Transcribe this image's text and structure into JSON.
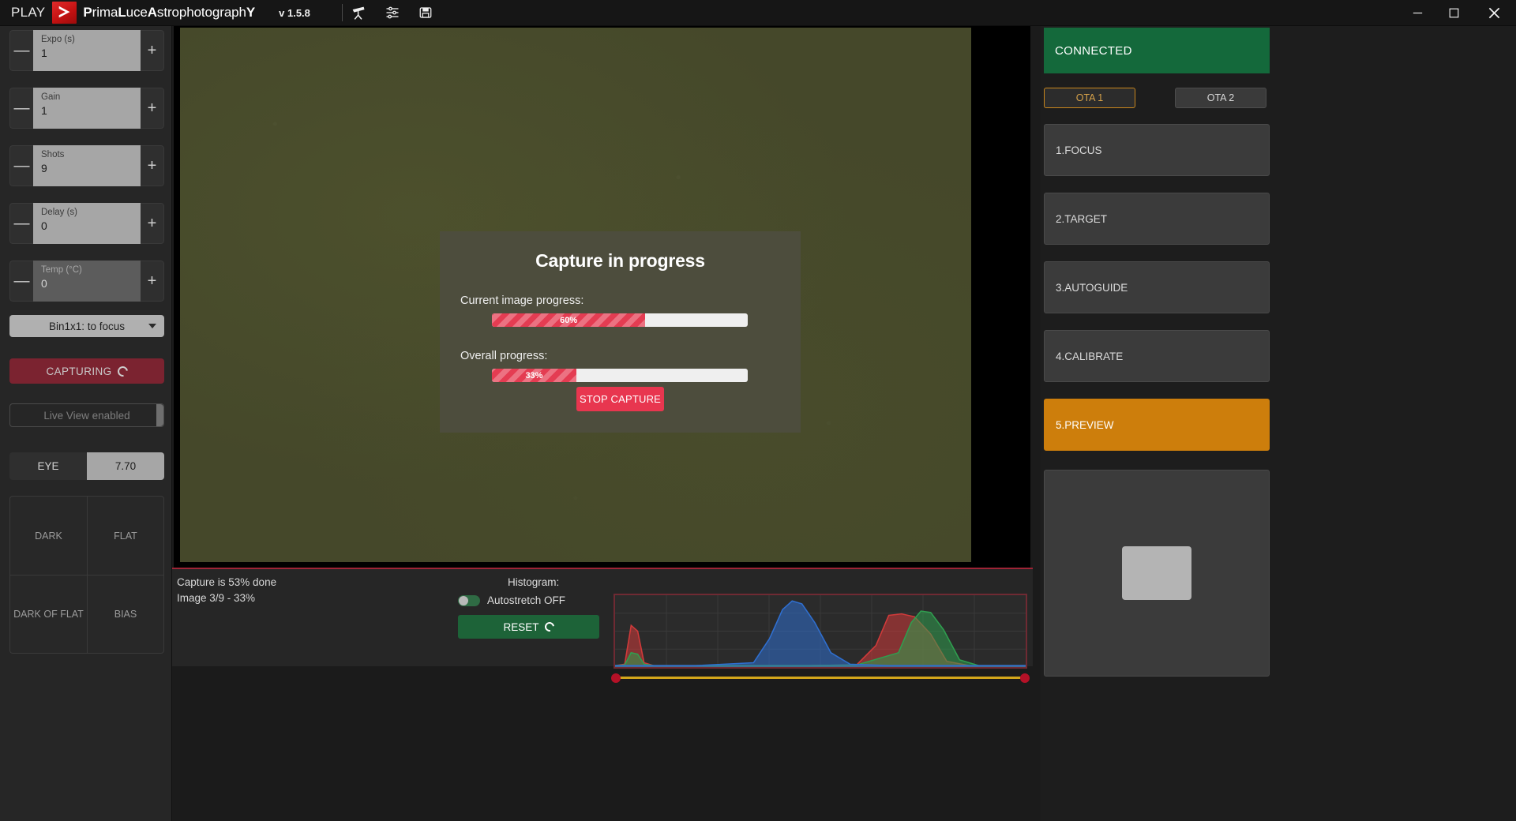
{
  "titlebar": {
    "play_label": "PLAY",
    "app_name_parts": [
      "P",
      "rima",
      "L",
      "uce",
      "A",
      "strophotograph",
      "Y"
    ],
    "app_name": "PrimaLuceAstrophotographY",
    "version": "v 1.5.8",
    "icons": [
      "telescope-icon",
      "sliders-icon",
      "save-icon"
    ],
    "window_controls": [
      "minimize",
      "maximize",
      "close"
    ]
  },
  "left_panel": {
    "steppers": [
      {
        "label": "Expo (s)",
        "value": "1",
        "minus": "—",
        "plus": "+",
        "disabled": false
      },
      {
        "label": "Gain",
        "value": "1",
        "minus": "—",
        "plus": "+",
        "disabled": false
      },
      {
        "label": "Shots",
        "value": "9",
        "minus": "—",
        "plus": "+",
        "disabled": false
      },
      {
        "label": "Delay (s)",
        "value": "0",
        "minus": "—",
        "plus": "+",
        "disabled": false
      },
      {
        "label": "Temp (°C)",
        "value": "0",
        "minus": "—",
        "plus": "+",
        "disabled": true
      }
    ],
    "bin_select": "Bin1x1: to focus",
    "capture_button": "CAPTURING",
    "liveview_button": "Live View enabled",
    "eye_label": "EYE",
    "eye_value": "7.70",
    "calibration": [
      "DARK",
      "FLAT",
      "DARK OF FLAT",
      "BIAS"
    ]
  },
  "modal": {
    "title": "Capture in progress",
    "current_label": "Current image progress:",
    "current_percent": 60,
    "current_percent_text": "60%",
    "overall_label": "Overall progress:",
    "overall_percent": 33,
    "overall_percent_text": "33%",
    "stop_button": "STOP CAPTURE"
  },
  "status_bar": {
    "line1": "Capture is 53% done",
    "line2": "Image 3/9 - 33%",
    "histogram_label": "Histogram:",
    "autostretch_label": "Autostretch OFF",
    "autostretch_on": false,
    "reset_button": "RESET"
  },
  "right_panel": {
    "connection_status": "CONNECTED",
    "ota_tabs": [
      {
        "label": "OTA 1",
        "active": true
      },
      {
        "label": "OTA 2",
        "active": false
      }
    ],
    "steps": [
      {
        "label": "1.FOCUS",
        "active": false
      },
      {
        "label": "2.TARGET",
        "active": false
      },
      {
        "label": "3.AUTOGUIDE",
        "active": false
      },
      {
        "label": "4.CALIBRATE",
        "active": false
      },
      {
        "label": "5.PREVIEW",
        "active": true
      }
    ]
  },
  "colors": {
    "accent_red": "#9e2436",
    "progress_red": "#e43c52",
    "stop_red": "#e8364f",
    "connected_green": "#14693b",
    "reset_green": "#1d6338",
    "active_orange": "#cd7e0c",
    "preview_olive": "#45482a"
  },
  "chart_data": {
    "type": "line",
    "title": "Histogram:",
    "xlabel": "",
    "ylabel": "",
    "xlim": [
      0,
      255
    ],
    "ylim": [
      0,
      100
    ],
    "grid": true,
    "legend": "none",
    "series": [
      {
        "name": "Red",
        "color": "#d03a3a",
        "x": [
          0,
          6,
          10,
          14,
          18,
          24,
          40,
          80,
          120,
          150,
          162,
          170,
          178,
          186,
          196,
          206,
          220,
          240,
          255
        ],
        "y": [
          2,
          4,
          58,
          50,
          6,
          2,
          2,
          2,
          2,
          3,
          30,
          72,
          74,
          70,
          46,
          8,
          2,
          2,
          2
        ]
      },
      {
        "name": "Green",
        "color": "#2f9e4f",
        "x": [
          0,
          6,
          10,
          14,
          18,
          24,
          40,
          80,
          120,
          150,
          176,
          184,
          190,
          196,
          204,
          214,
          226,
          240,
          255
        ],
        "y": [
          2,
          3,
          20,
          18,
          4,
          2,
          2,
          2,
          2,
          3,
          20,
          62,
          78,
          76,
          52,
          10,
          2,
          2,
          2
        ]
      },
      {
        "name": "Blue",
        "color": "#2f6fd0",
        "x": [
          0,
          6,
          20,
          50,
          86,
          96,
          104,
          110,
          116,
          124,
          134,
          146,
          170,
          200,
          230,
          255
        ],
        "y": [
          2,
          2,
          2,
          2,
          6,
          40,
          80,
          92,
          88,
          62,
          20,
          4,
          2,
          2,
          2,
          2
        ]
      }
    ]
  }
}
